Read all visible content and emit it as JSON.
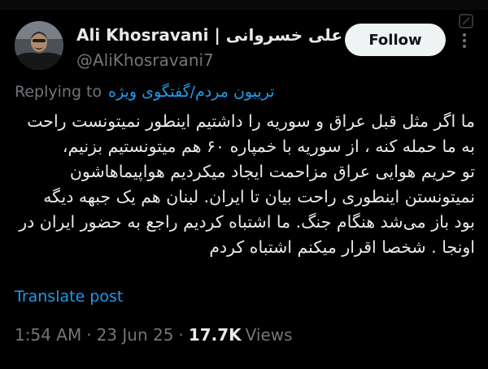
{
  "tweet": {
    "author": {
      "display_name": "Ali Khosravani | علی خسروانی",
      "handle": "@AliKhosravani7",
      "verified": true
    },
    "follow_label": "Follow",
    "replying_prefix": "Replying to",
    "replying_to": "تریبون مردم/گفتگوی ویژه",
    "text_lines": [
      "ما اگر مثل قبل عراق و سوریه را داشتیم اینطور نمیتونست راحت",
      "به ما حمله کنه ، از سوریه با خمپاره ۶۰ هم میتونستیم بزنیم،",
      "تو حریم هوایی عراق مزاحمت ایجاد میکردیم هواپیماهاشون",
      "نمیتونستن اینطوری راحت بیان تا ایران. لبنان هم یک جبهه دیگه",
      "بود باز می‌شد هنگام جنگ. ما اشتباه کردیم راجع به حضور ایران در",
      "اونجا . شخصا اقرار میکنم اشتباه کردم"
    ],
    "translate_label": "Translate post",
    "time": "1:54 AM",
    "date": "23 Jun 25",
    "views_count": "17.7K",
    "views_label": "Views",
    "separator": "·"
  },
  "colors": {
    "background": "#000000",
    "text": "#e7e9ea",
    "secondary": "#71767b",
    "link": "#1d9bf0",
    "follow_bg": "#eff3f4"
  },
  "icons": {
    "verified": "verified-badge-icon",
    "more": "more-options-icon",
    "grok": "grok-icon"
  }
}
